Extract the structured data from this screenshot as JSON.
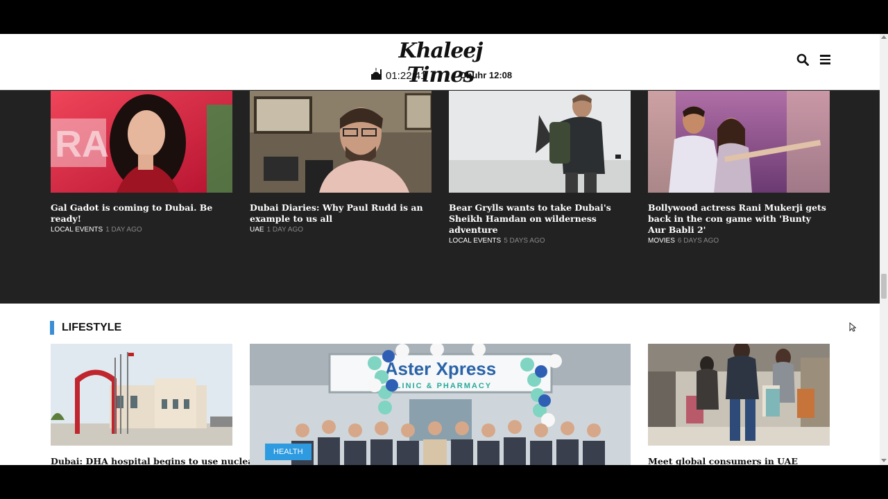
{
  "header": {
    "logo": "Khaleej Times",
    "clock": "01:22:41",
    "prayer": "Dhuhr 12:08"
  },
  "top_stories": [
    {
      "title": "Gal Gadot is coming to Dubai. Be ready!",
      "category": "LOCAL EVENTS",
      "time": "1 DAY AGO"
    },
    {
      "title": "Dubai Diaries: Why Paul Rudd is an example to us all",
      "category": "UAE",
      "time": "1 DAY AGO"
    },
    {
      "title": "Bear Grylls wants to take Dubai's Sheikh Hamdan on wilderness adventure",
      "category": "LOCAL EVENTS",
      "time": "5 DAYS AGO"
    },
    {
      "title": "Bollywood actress Rani Mukerji gets back in the con game with 'Bunty Aur Babli 2'",
      "category": "MOVIES",
      "time": "6 DAYS AGO"
    }
  ],
  "lifestyle": {
    "section_title": "LIFESTYLE",
    "cards": [
      {
        "title": "Dubai: DHA hospital begins to use nuclear"
      },
      {
        "badge": "HEALTH",
        "sign_line1": "Aster Xpress",
        "sign_line2": "CLINIC & PHARMACY"
      },
      {
        "title": "Meet global consumers in UAE"
      }
    ]
  }
}
